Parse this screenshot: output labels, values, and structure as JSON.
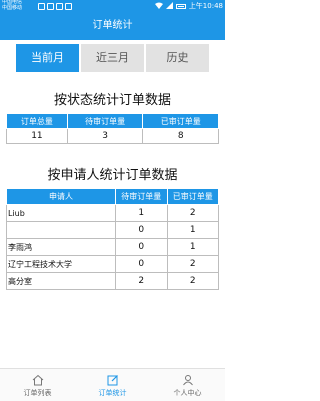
{
  "status_bar": {
    "carrier_line1": "中国电信 ",
    "carrier_line2": "中国移动 ",
    "time": "上午10:48"
  },
  "app_bar": {
    "title": "订单统计"
  },
  "tabs": [
    {
      "label": "当前月",
      "active": true
    },
    {
      "label": "近三月",
      "active": false
    },
    {
      "label": "历史",
      "active": false
    }
  ],
  "by_status": {
    "title": "按状态统计订单数据",
    "headers": [
      "订单总量",
      "待审订单量",
      "已审订单量"
    ],
    "values": [
      "11",
      "3",
      "8"
    ]
  },
  "by_applicant": {
    "title": "按申请人统计订单数据",
    "headers": [
      "申请人",
      "待审订单量",
      "已审订单量"
    ],
    "rows": [
      {
        "name": "Liub",
        "pending": "1",
        "approved": "2"
      },
      {
        "name": "",
        "pending": "0",
        "approved": "1"
      },
      {
        "name": "李雨鸿",
        "pending": "0",
        "approved": "1"
      },
      {
        "name": "辽宁工程技术大学",
        "pending": "0",
        "approved": "2"
      },
      {
        "name": "高分室",
        "pending": "2",
        "approved": "2"
      }
    ]
  },
  "bottom_nav": [
    {
      "label": "订单列表",
      "icon": "home-icon"
    },
    {
      "label": "订单统计",
      "icon": "edit-icon",
      "active": true
    },
    {
      "label": "个人中心",
      "icon": "person-icon"
    }
  ],
  "colors": {
    "accent": "#1e96e6"
  }
}
